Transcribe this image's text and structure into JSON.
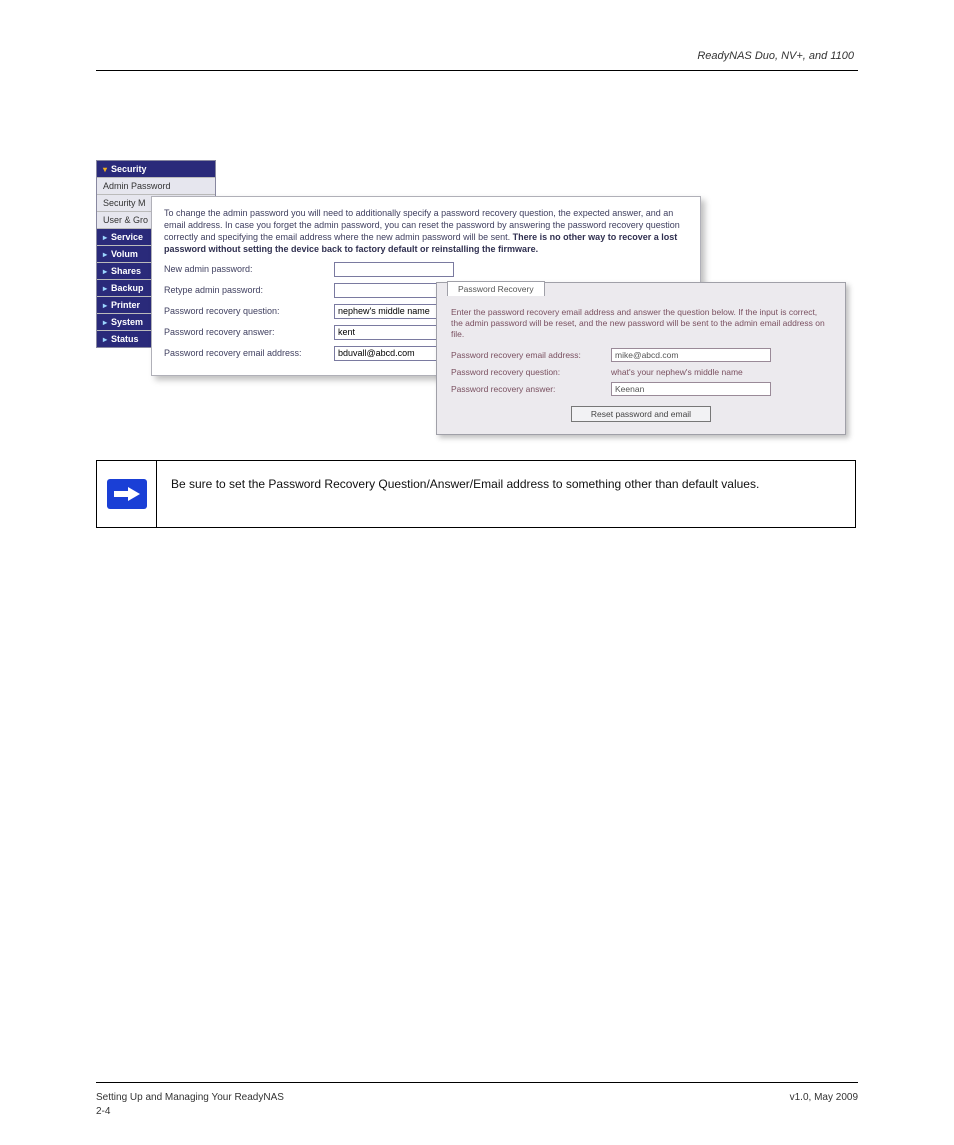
{
  "header": {
    "running": "ReadyNAS Duo, NV+, and 1100"
  },
  "footer": {
    "left": "Setting Up and Managing Your ReadyNAS",
    "right": "v1.0, May 2009",
    "page": "2-4"
  },
  "sidebar": {
    "title": "Security",
    "light_items": [
      "Admin Password",
      "Security M",
      "User & Gro"
    ],
    "dark_items": [
      "Service",
      "Volum",
      "Shares",
      "Backup",
      "Printer",
      "System",
      "Status"
    ]
  },
  "admin_panel": {
    "intro_pre": "To change the admin password you will need to additionally specify a password recovery question, the expected answer, and an email address. In case you forget the admin password, you can reset the password by answering the password recovery question correctly and specifying the email address where the new admin password will be sent. ",
    "intro_bold": "There is no other way to recover a lost password without setting the device back to factory default or reinstalling the firmware.",
    "rows": {
      "new_pw_label": "New admin password:",
      "new_pw_value": "",
      "retype_label": "Retype admin password:",
      "retype_value": "",
      "question_label": "Password recovery question:",
      "question_value": "nephew's middle name",
      "answer_label": "Password recovery answer:",
      "answer_value": "kent",
      "email_label": "Password recovery email address:",
      "email_value": "bduvall@abcd.com"
    }
  },
  "recovery_panel": {
    "tab": "Password Recovery",
    "intro": "Enter the password recovery email address and answer the question below. If the input is correct, the admin password will be reset, and the new password will be sent to the admin email address on file.",
    "email_label": "Password recovery email address:",
    "email_value": "mike@abcd.com",
    "question_label": "Password recovery question:",
    "question_value": "what's your nephew's middle name",
    "answer_label": "Password recovery answer:",
    "answer_value": "Keenan",
    "button": "Reset password and email"
  },
  "note": {
    "text": "Be sure to set the Password Recovery Question/Answer/Email address to something other than default values."
  }
}
